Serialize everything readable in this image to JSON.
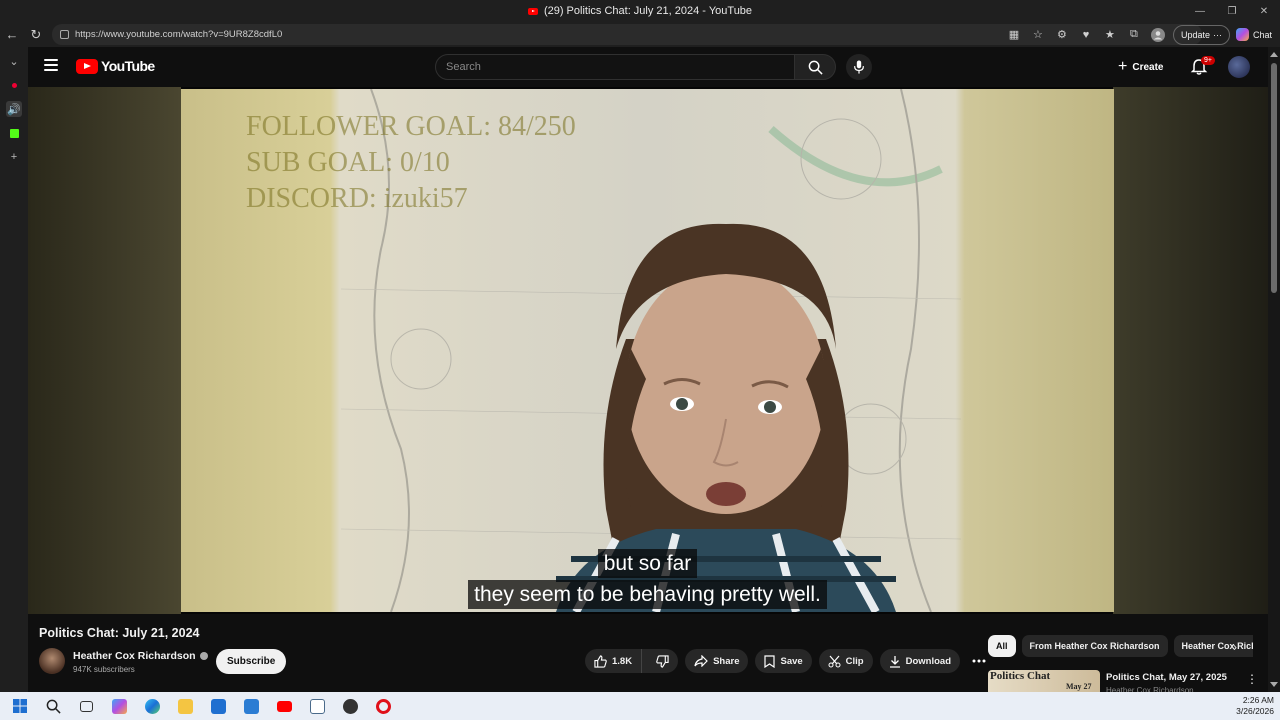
{
  "browser": {
    "window_title": "(29) Politics Chat: July 21, 2024 - YouTube",
    "url": "https://www.youtube.com/watch?v=9UR8Z8cdfL0",
    "update_label": "Update",
    "update_more": "···",
    "chat_label": "Chat"
  },
  "youtube": {
    "logo_text": "YouTube",
    "search_placeholder": "Search",
    "create_label": "Create",
    "notification_count": "9+"
  },
  "video": {
    "overlay_lines": [
      "FOLLOWER GOAL: 84/250",
      "SUB GOAL: 0/10",
      "DISCORD: izuki57"
    ],
    "captions": [
      "but so far",
      "they seem to be behaving pretty well."
    ],
    "title": "Politics Chat: July 21, 2024",
    "channel": "Heather Cox Richardson",
    "subscribers": "947K subscribers",
    "subscribe_label": "Subscribe",
    "like_count": "1.8K",
    "share_label": "Share",
    "save_label": "Save",
    "clip_label": "Clip",
    "download_label": "Download"
  },
  "recommendations": {
    "chips": [
      "All",
      "From Heather Cox Richardson",
      "Heather Cox Richardson"
    ],
    "first": {
      "thumb_text": "Politics Chat",
      "thumb_date": "May 27",
      "title": "Politics Chat, May 27, 2025",
      "channel": "Heather Cox Richardson"
    }
  },
  "taskbar": {
    "time": "2:26 AM",
    "date": "3/26/2026"
  },
  "colors": {
    "brand_red": "#ff0000",
    "background": "#0f0f0f",
    "notification": "#cc0000"
  }
}
